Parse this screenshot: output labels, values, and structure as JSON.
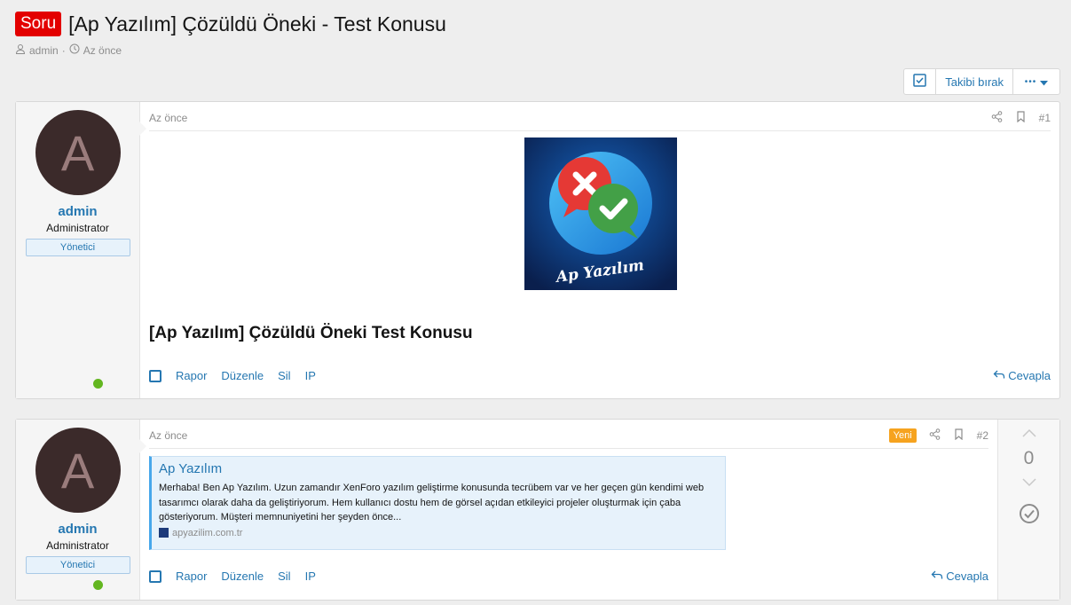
{
  "thread": {
    "prefix": "Soru",
    "title": "[Ap Yazılım] Çözüldü Öneki - Test Konusu",
    "author": "admin",
    "separator": "·",
    "time": "Az önce"
  },
  "actions": {
    "unfollow_label": "Takibi bırak",
    "more_label": "•••"
  },
  "posts": [
    {
      "date": "Az önce",
      "number": "#1",
      "user": {
        "avatar_letter": "A",
        "name": "admin",
        "title": "Administrator",
        "banner": "Yönetici"
      },
      "image_label": "Ap Yazılım",
      "body_text": "[Ap Yazılım] Çözüldü Öneki Test Konusu",
      "footer": {
        "report": "Rapor",
        "edit": "Düzenle",
        "delete": "Sil",
        "ip": "IP",
        "reply": "Cevapla"
      }
    },
    {
      "date": "Az önce",
      "number": "#2",
      "new_badge": "Yeni",
      "user": {
        "avatar_letter": "A",
        "name": "admin",
        "title": "Administrator",
        "banner": "Yönetici"
      },
      "unfurl": {
        "title": "Ap Yazılım",
        "description": "Merhaba! Ben Ap Yazılım. Uzun zamandır XenForo yazılım geliştirme konusunda tecrübem var ve her geçen gün kendimi web tasarımcı olarak daha da geliştiriyorum. Hem kullanıcı dostu hem de görsel açıdan etkileyici projeler oluşturmak için çaba gösteriyorum. Müşteri memnuniyetini her şeyden önce...",
        "domain": "apyazilim.com.tr"
      },
      "votes": "0",
      "footer": {
        "report": "Rapor",
        "edit": "Düzenle",
        "delete": "Sil",
        "ip": "IP",
        "reply": "Cevapla"
      }
    }
  ],
  "colors": {
    "prefix_bg": "#e30000",
    "link": "#2577b1",
    "online": "#63b620",
    "new_badge": "#f6a31f"
  }
}
